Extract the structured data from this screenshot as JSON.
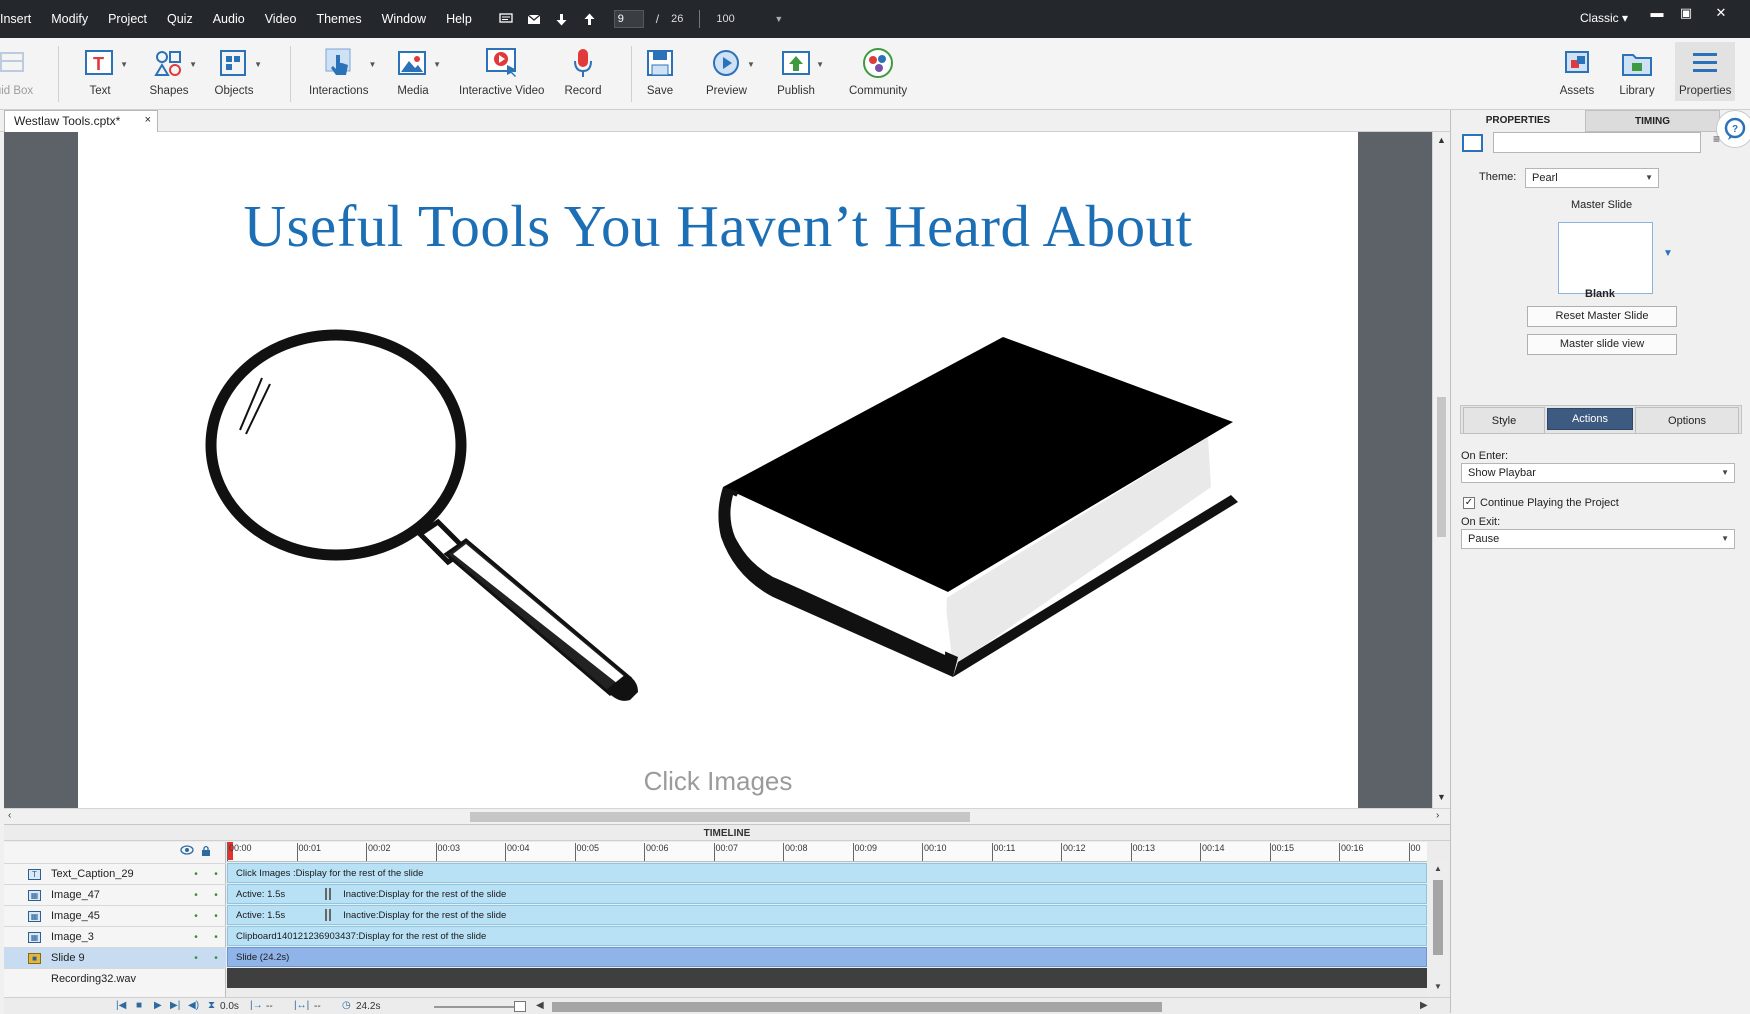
{
  "menubar": {
    "items": [
      "Insert",
      "Modify",
      "Project",
      "Quiz",
      "Audio",
      "Video",
      "Themes",
      "Window",
      "Help"
    ],
    "current_slide": "9",
    "slide_separator": "/",
    "total_slides": "26",
    "zoom": "100",
    "workspace": "Classic",
    "workspace_caret": "▾",
    "minimize": "▬",
    "maximize": "▣",
    "close": "✕"
  },
  "toolbar": {
    "fluid_box_partial": "uid Box",
    "text": "Text",
    "shapes": "Shapes",
    "objects": "Objects",
    "interactions": "Interactions",
    "media": "Media",
    "interactive_video": "Interactive Video",
    "record": "Record",
    "save": "Save",
    "preview": "Preview",
    "publish": "Publish",
    "community": "Community",
    "assets": "Assets",
    "library": "Library",
    "properties": "Properties"
  },
  "document": {
    "tab_name": "Westlaw Tools.cptx*",
    "close_glyph": "×"
  },
  "slide": {
    "title": "Useful Tools You Haven’t Heard About",
    "caption": "Click Images"
  },
  "timeline": {
    "header": "TIMELINE",
    "ticks": [
      "00:00",
      "00:01",
      "00:02",
      "00:03",
      "00:04",
      "00:05",
      "00:06",
      "00:07",
      "00:08",
      "00:09",
      "00:10",
      "00:11",
      "00:12",
      "00:13",
      "00:14",
      "00:15",
      "00:16",
      "00"
    ],
    "rows": [
      {
        "name": "Text_Caption_29",
        "icon": "T",
        "track": "Click Images :Display for the rest of the slide",
        "active": "",
        "inactive": "",
        "style": "light"
      },
      {
        "name": "Image_47",
        "icon": "▦",
        "track": "",
        "active": "Active: 1.5s",
        "inactive": "Inactive:Display for the rest of the slide",
        "style": "light"
      },
      {
        "name": "Image_45",
        "icon": "▦",
        "track": "",
        "active": "Active: 1.5s",
        "inactive": "Inactive:Display for the rest of the slide",
        "style": "light"
      },
      {
        "name": "Image_3",
        "icon": "▦",
        "track": "Clipboard140121236903437:Display for the rest of the slide",
        "active": "",
        "inactive": "",
        "style": "light"
      },
      {
        "name": "Slide 9",
        "icon": "■",
        "track": "Slide (24.2s)",
        "active": "",
        "inactive": "",
        "style": "slide"
      },
      {
        "name": "Recording32.wav",
        "icon": "",
        "track": "",
        "active": "",
        "inactive": "",
        "style": "audio"
      }
    ],
    "footer": {
      "start_time": "0.0s",
      "in_value": "--",
      "out_value": "--",
      "duration": "24.2s"
    }
  },
  "panel": {
    "tab_properties": "PROPERTIES",
    "tab_timing": "TIMING",
    "slide_name_value": "",
    "theme_label": "Theme:",
    "theme_value": "Pearl",
    "master_slide_label": "Master Slide",
    "master_slide_name": "Blank",
    "reset_master_button": "Reset Master Slide",
    "master_view_button": "Master slide view",
    "seg_style": "Style",
    "seg_actions": "Actions",
    "seg_options": "Options",
    "on_enter_label": "On Enter:",
    "on_enter_value": "Show Playbar",
    "continue_label": "Continue Playing the Project",
    "continue_checked": "✓",
    "on_exit_label": "On Exit:",
    "on_exit_value": "Pause"
  },
  "colors": {
    "menubar_bg": "#24272c",
    "title_blue": "#1d6fb5",
    "accent": "#2b72b8",
    "track_light": "#b8e1f5",
    "track_slide": "#8fb4ea",
    "actions_active": "#3d5a80"
  }
}
